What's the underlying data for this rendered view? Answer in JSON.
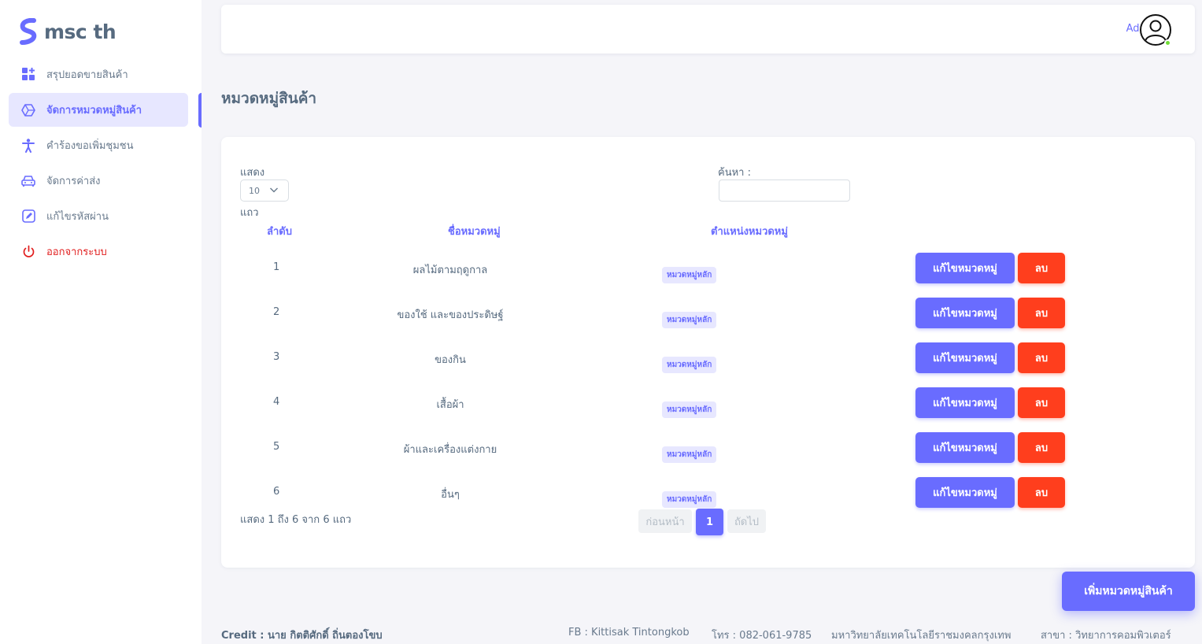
{
  "brand": {
    "name": "msc th",
    "logo_icon": "s-logo-icon",
    "accent": "#696cff"
  },
  "sidebar": {
    "items": [
      {
        "label": "สรุปยอดขายสินค้า",
        "icon": "dashboard-icon",
        "active": false
      },
      {
        "label": "จัดการหมวดหมู่สินค้า",
        "icon": "hexagon-icon",
        "active": true
      },
      {
        "label": "คำร้องขอเพิ่มชุมชน",
        "icon": "person-icon",
        "active": false
      },
      {
        "label": "จัดการค่าส่ง",
        "icon": "car-icon",
        "active": false
      },
      {
        "label": "แก้ไขรหัสผ่าน",
        "icon": "edit-icon",
        "active": false
      },
      {
        "label": "ออกจากระบบ",
        "icon": "power-icon",
        "active": false
      }
    ]
  },
  "navbar": {
    "user": "Admin",
    "avatar_icon": "user-avatar-icon",
    "status_color": "#71dd37"
  },
  "page": {
    "title": "หมวดหมู่สินค้า"
  },
  "table": {
    "length_label": "แสดง",
    "length_value": "10",
    "length_suffix": "แถว",
    "search_label": "ค้นหา :",
    "search_value": "",
    "headers": [
      "ลำดับ",
      "ชื่อหมวดหมู่",
      "ตำแหน่งหมวดหมู่"
    ],
    "rows": [
      {
        "no": "1",
        "name": "ผลไม้ตามฤดูกาล",
        "position": "หมวดหมู่หลัก"
      },
      {
        "no": "2",
        "name": "ของใช้ และของประดิษฐ์",
        "position": "หมวดหมู่หลัก"
      },
      {
        "no": "3",
        "name": "ของกิน",
        "position": "หมวดหมู่หลัก"
      },
      {
        "no": "4",
        "name": "เสื้อผ้า",
        "position": "หมวดหมู่หลัก"
      },
      {
        "no": "5",
        "name": "ผ้าและเครื่องแต่งกาย",
        "position": "หมวดหมู่หลัก"
      },
      {
        "no": "6",
        "name": "อื่นๆ",
        "position": "หมวดหมู่หลัก"
      }
    ],
    "edit_label": "แก้ไขหมวดหมู่",
    "delete_label": "ลบ",
    "info": "แสดง 1 ถึง 6 จาก 6 แถว",
    "pagination": {
      "prev": "ก่อนหน้า",
      "current": "1",
      "next": "ถัดไป"
    }
  },
  "add_button": "เพิ่มหมวดหมู่สินค้า",
  "footer": {
    "credit": "Credit : นาย กิตติศักดิ์ ถิ่นตองโขบ",
    "fb": "FB : Kittisak Tintongkob",
    "tel": "โทร : 082-061-9785",
    "university": "มหาวิทยาลัยเทคโนโลยีราชมงคลกรุงเทพ",
    "branch": "สาขา : วิทยาการคอมพิวเตอร์"
  },
  "colors": {
    "primary": "#696cff",
    "danger": "#ff3e1d",
    "badge_bg": "#e7e7ff",
    "text": "#566a7f"
  }
}
